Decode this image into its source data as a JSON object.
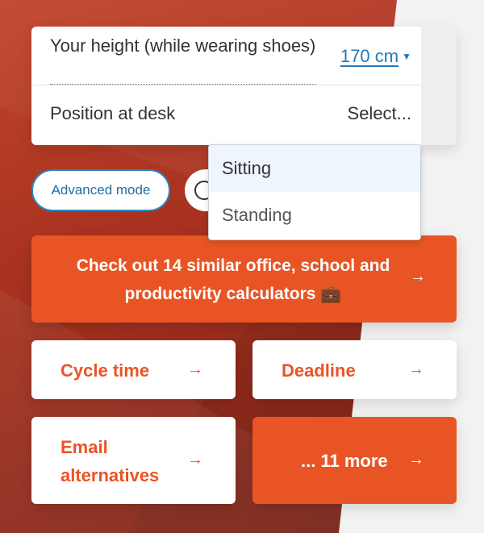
{
  "form": {
    "height_label": "Your height (while wearing shoes)",
    "height_value": "170 cm",
    "position_label": "Position at desk",
    "position_value": "Select..."
  },
  "dropdown": {
    "options": [
      "Sitting",
      "Standing"
    ],
    "highlighted": "Sitting"
  },
  "controls": {
    "advanced_mode": "Advanced mode"
  },
  "promo": {
    "text": "Check out 14 similar office, school and productivity calculators 💼",
    "arrow": "→"
  },
  "related": [
    {
      "label": "Cycle time",
      "arrow": "→"
    },
    {
      "label": "Deadline",
      "arrow": "→"
    },
    {
      "label": "Email alternatives",
      "arrow": "→"
    },
    {
      "label": "... 11 more",
      "arrow": "→"
    }
  ],
  "colors": {
    "accent": "#e95424",
    "link": "#1f7bb6",
    "highlight": "#eef5fd"
  }
}
